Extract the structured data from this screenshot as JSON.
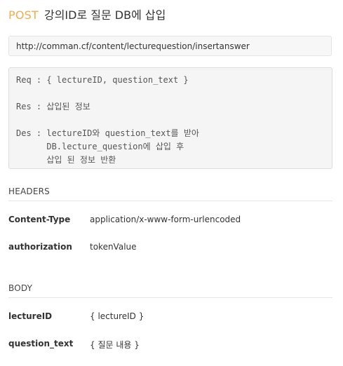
{
  "endpoint": {
    "method": "POST",
    "title": "강의ID로 질문 DB에 삽입",
    "url": "http://comman.cf/content/lecturequestion/insertanswer"
  },
  "description": {
    "req": "Req : { lectureID, question_text }",
    "res": "Res : 삽입된 정보",
    "des_line1": "Des : lectureID와 question_text를 받아",
    "des_line2": "      DB.lecture_question에 삽입 후",
    "des_line3": "      삽입 된 정보 반환"
  },
  "headers": {
    "section_title": "HEADERS",
    "rows": [
      {
        "key": "Content-Type",
        "value": "application/x-www-form-urlencoded"
      },
      {
        "key": "authorization",
        "value": "tokenValue"
      }
    ]
  },
  "body": {
    "section_title": "BODY",
    "rows": [
      {
        "key": "lectureID",
        "value": "{ lectureID }"
      },
      {
        "key": "question_text",
        "value": "{ 질문 내용 }"
      }
    ]
  },
  "colors": {
    "method": "#f0ad4e",
    "text": "#333333",
    "box_background": "#f5f5f5",
    "border": "#dddddd"
  }
}
